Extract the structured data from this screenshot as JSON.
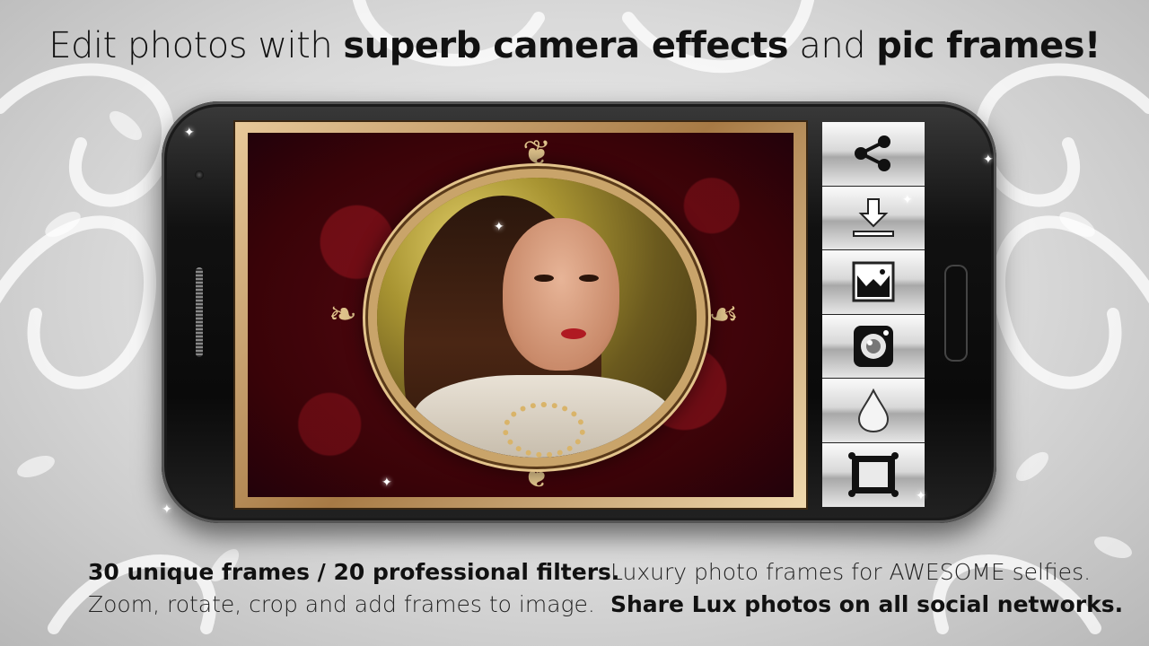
{
  "headline": {
    "part1": "Edit photos with ",
    "part2": "superb camera effects",
    "part3": " and ",
    "part4": "pic frames!"
  },
  "toolbar": {
    "items": [
      {
        "icon": "share-icon"
      },
      {
        "icon": "download-icon"
      },
      {
        "icon": "filter-icon"
      },
      {
        "icon": "camera-effect-icon"
      },
      {
        "icon": "drop-icon"
      },
      {
        "icon": "frame-icon"
      }
    ]
  },
  "features": {
    "left": {
      "line1": "30 unique frames / 20 professional filters.",
      "line2": "Zoom, rotate, crop and add frames to image."
    },
    "right": {
      "line1": "Luxury photo frames for AWESOME selfies.",
      "line2": "Share Lux photos on all social networks."
    }
  },
  "colors": {
    "frame_gold": "#c9a46a",
    "damask_red": "#5a0a12",
    "phone_black": "#0a0a0a"
  }
}
